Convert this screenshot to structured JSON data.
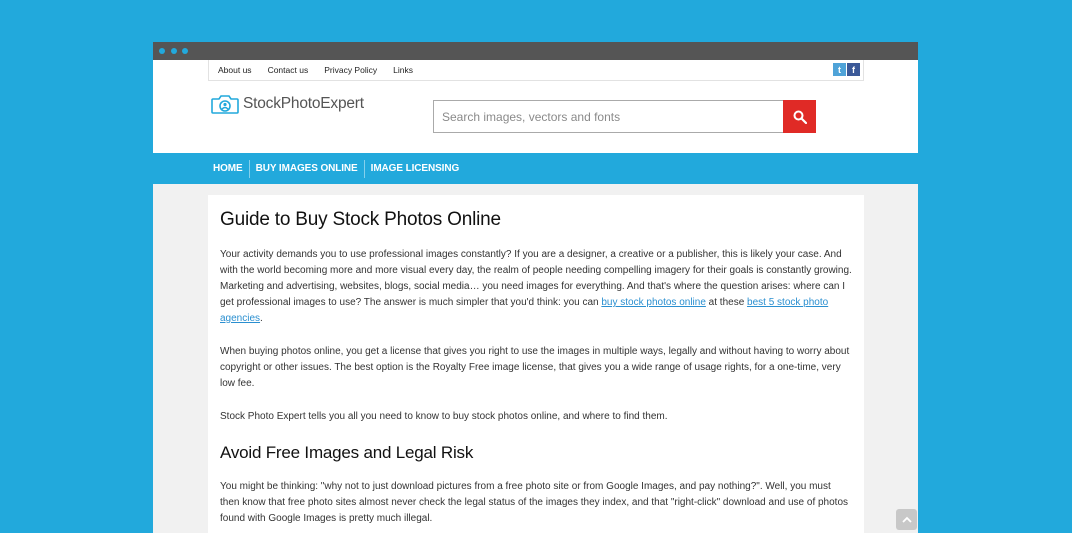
{
  "window": {
    "accent": "#22a9dc",
    "titlebar_color": "#555555"
  },
  "topbar": {
    "links": [
      "About us",
      "Contact us",
      "Privacy Policy",
      "Links"
    ],
    "social": [
      {
        "icon": "twitter-icon",
        "glyph": "t"
      },
      {
        "icon": "facebook-icon",
        "glyph": "f"
      }
    ]
  },
  "logo": {
    "text": "StockPhotoExpert",
    "icon": "camera-icon"
  },
  "search": {
    "placeholder": "Search images, vectors and fonts",
    "value": "",
    "button_icon": "search-icon",
    "button_color": "#e02a26"
  },
  "nav": {
    "items": [
      "HOME",
      "BUY IMAGES ONLINE",
      "IMAGE LICENSING"
    ]
  },
  "article": {
    "title": "Guide to Buy Stock Photos Online",
    "p1_text": "Your activity demands you to use professional images constantly? If you are a designer, a creative or a publisher, this is likely your case. And with the world becoming more and more visual every day, the realm of people needing compelling imagery for their goals is constantly growing. Marketing and advertising, websites, blogs, social media… you need images for everything. And that's where the question arises: where can I get professional images to use? The answer is much simpler that you'd think: you can ",
    "p1_link1": "buy stock photos online",
    "p1_mid": " at these ",
    "p1_link2": "best 5 stock photo agencies",
    "p1_end": ".",
    "p2": "When buying photos online, you get a license that gives you right to use the images in multiple ways, legally and without having to worry about copyright or other issues. The best option is the Royalty Free image license, that gives you a wide range of usage rights, for a one-time, very low fee.",
    "p3": "Stock Photo Expert tells you all you need to know to buy stock photos online, and where to find them.",
    "h2": "Avoid Free Images and Legal Risk",
    "p4": "You might be thinking: \"why not to just download pictures from a free photo site or from Google Images, and pay nothing?\". Well, you must then know that free photo sites almost never check the legal status of the images they index, and that \"right-click\" download and use of photos found with Google Images is pretty much illegal."
  },
  "scroll_top": {
    "icon": "chevron-up-icon"
  }
}
